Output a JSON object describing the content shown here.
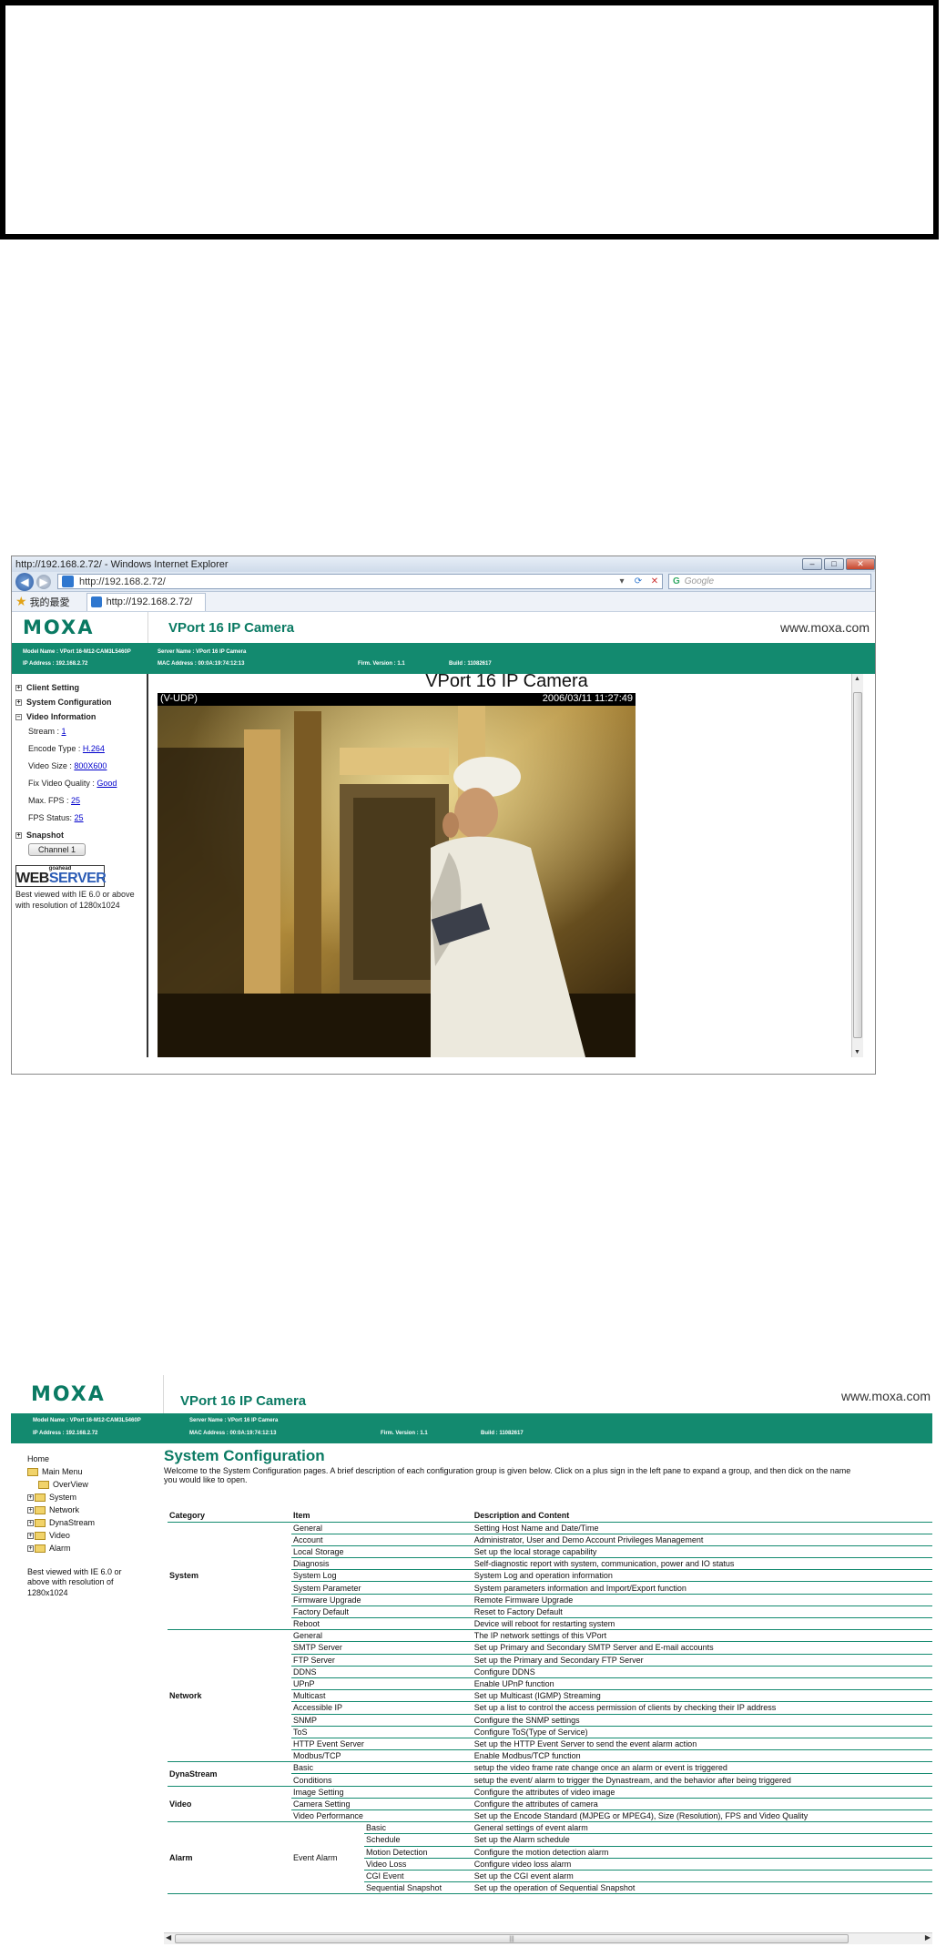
{
  "browser": {
    "title": "http://192.168.2.72/ - Windows Internet Explorer",
    "url": "http://192.168.2.72/",
    "search_placeholder": "Google",
    "favorites_label": "我的最愛",
    "tab_label": "http://192.168.2.72/"
  },
  "moxa": {
    "logo": "MOXA",
    "product": "VPort 16 IP Camera",
    "site": "www.moxa.com",
    "model": "Model Name : VPort 16-M12-CAM3L5460P",
    "server": "Server Name : VPort 16 IP Camera",
    "ip": "IP Address : 192.168.2.72",
    "mac": "MAC Address : 00:0A:19:74:12:13",
    "firmware": "Firm. Version : 1.1",
    "build": "Build : 11082617"
  },
  "client": {
    "menu": {
      "client_setting": "Client Setting",
      "system_configuration": "System Configuration",
      "video_information": "Video Information",
      "snapshot": "Snapshot"
    },
    "video_info": {
      "stream_label": "Stream :",
      "stream_value": "1",
      "encode_label": "Encode Type :",
      "encode_value": "H.264",
      "size_label": "Video Size :",
      "size_value": "800X600",
      "quality_label": "Fix Video Quality :",
      "quality_value": "Good",
      "maxfps_label": "Max. FPS :",
      "maxfps_value": "25",
      "fps_label": "FPS Status:",
      "fps_value": "25"
    },
    "channel_button": "Channel 1",
    "webserver": {
      "small": "goahead",
      "big1": "WEB",
      "big2": "SERVER"
    },
    "best_view": "Best viewed with IE 6.0 or above with resolution of 1280x1024",
    "camera_title": "VPort 16 IP Camera",
    "video": {
      "left": "(V-UDP)",
      "right": "2006/03/11 11:27:49"
    }
  },
  "syscfg": {
    "tree": {
      "home": "Home",
      "main_menu": "Main Menu",
      "overview": "OverView",
      "system": "System",
      "network": "Network",
      "dynastream": "DynaStream",
      "video": "Video",
      "alarm": "Alarm"
    },
    "best_view": "Best viewed with IE 6.0 or above with resolution of 1280x1024",
    "heading": "System Configuration",
    "intro1": "Welcome to the System Configuration pages. A brief description of each configuration group is given below. Click on a plus sign in the left pane to expand a group, and then dick on the name",
    "intro2": "you would like to open.",
    "columns": {
      "category": "Category",
      "item": "Item",
      "desc": "Description and Content"
    },
    "groups": [
      {
        "category": "System",
        "rows": [
          [
            "General",
            "Setting Host Name and Date/Time"
          ],
          [
            "Account",
            "Administrator, User and Demo Account Privileges Management"
          ],
          [
            "Local Storage",
            "Set up the local storage capability"
          ],
          [
            "Diagnosis",
            "Self-diagnostic report with system, communication, power and IO status"
          ],
          [
            "System Log",
            "System Log and operation information"
          ],
          [
            "System Parameter",
            "System parameters information and Import/Export function"
          ],
          [
            "Firmware Upgrade",
            "Remote Firmware Upgrade"
          ],
          [
            "Factory Default",
            "Reset to Factory Default"
          ],
          [
            "Reboot",
            "Device will reboot for restarting system"
          ]
        ]
      },
      {
        "category": "Network",
        "rows": [
          [
            "General",
            "The IP network settings of this VPort"
          ],
          [
            "SMTP Server",
            "Set up Primary and Secondary SMTP Server and E-mail accounts"
          ],
          [
            "FTP Server",
            "Set up the Primary and Secondary FTP Server"
          ],
          [
            "DDNS",
            "Configure DDNS"
          ],
          [
            "UPnP",
            "Enable UPnP function"
          ],
          [
            "Multicast",
            "Set up Multicast (IGMP) Streaming"
          ],
          [
            "Accessible IP",
            "Set up a list to control the access permission of clients by checking their IP address"
          ],
          [
            "SNMP",
            "Configure the SNMP settings"
          ],
          [
            "ToS",
            "Configure ToS(Type of Service)"
          ],
          [
            "HTTP Event Server",
            "Set up the HTTP Event Server to send the event alarm action"
          ],
          [
            "Modbus/TCP",
            "Enable Modbus/TCP function"
          ]
        ]
      },
      {
        "category": "DynaStream",
        "rows": [
          [
            "Basic",
            "setup the video frame rate change once an alarm or event is triggered"
          ],
          [
            "Conditions",
            "setup the event/ alarm to trigger the Dynastream, and the behavior after being triggered"
          ]
        ]
      },
      {
        "category": "Video",
        "rows": [
          [
            "Image Setting",
            "Configure the attributes of video image"
          ],
          [
            "Camera Setting",
            "Configure the attributes of camera"
          ],
          [
            "Video Performance",
            "Set up the Encode Standard (MJPEG or MPEG4), Size (Resolution), FPS and Video Quality"
          ]
        ]
      },
      {
        "category": "Alarm",
        "item": "Event Alarm",
        "rows": [
          [
            "Basic",
            "General settings of event alarm"
          ],
          [
            "Schedule",
            "Set up the Alarm schedule"
          ],
          [
            "Motion Detection",
            "Configure the motion detection alarm"
          ],
          [
            "Video Loss",
            "Configure video loss alarm"
          ],
          [
            "CGI Event",
            "Set up the CGI event alarm"
          ],
          [
            "Sequential Snapshot",
            "Set up the operation of Sequential Snapshot"
          ]
        ]
      }
    ]
  }
}
